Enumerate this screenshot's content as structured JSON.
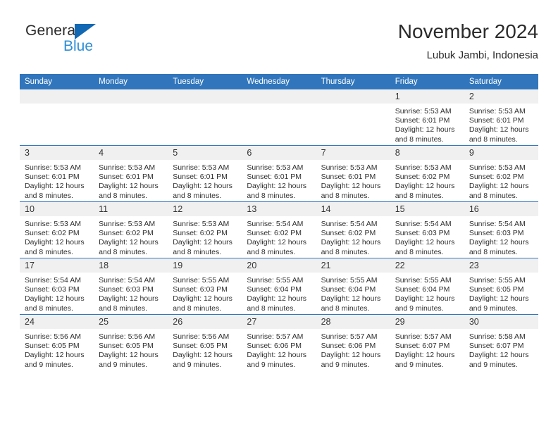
{
  "brand": {
    "name_part1": "General",
    "name_part2": "Blue",
    "triangle_color": "#1268b3",
    "blue_color": "#2e8ed6"
  },
  "header": {
    "title": "November 2024",
    "subtitle": "Lubuk Jambi, Indonesia"
  },
  "theme": {
    "header_blue": "#3176bc",
    "daynum_gray": "#f0f0f0",
    "text_color": "#2f2f2f"
  },
  "weekdays": [
    "Sunday",
    "Monday",
    "Tuesday",
    "Wednesday",
    "Thursday",
    "Friday",
    "Saturday"
  ],
  "weeks": [
    [
      {
        "day": "",
        "sunrise": "",
        "sunset": "",
        "daylight1": "",
        "daylight2": ""
      },
      {
        "day": "",
        "sunrise": "",
        "sunset": "",
        "daylight1": "",
        "daylight2": ""
      },
      {
        "day": "",
        "sunrise": "",
        "sunset": "",
        "daylight1": "",
        "daylight2": ""
      },
      {
        "day": "",
        "sunrise": "",
        "sunset": "",
        "daylight1": "",
        "daylight2": ""
      },
      {
        "day": "",
        "sunrise": "",
        "sunset": "",
        "daylight1": "",
        "daylight2": ""
      },
      {
        "day": "1",
        "sunrise": "Sunrise: 5:53 AM",
        "sunset": "Sunset: 6:01 PM",
        "daylight1": "Daylight: 12 hours",
        "daylight2": "and 8 minutes."
      },
      {
        "day": "2",
        "sunrise": "Sunrise: 5:53 AM",
        "sunset": "Sunset: 6:01 PM",
        "daylight1": "Daylight: 12 hours",
        "daylight2": "and 8 minutes."
      }
    ],
    [
      {
        "day": "3",
        "sunrise": "Sunrise: 5:53 AM",
        "sunset": "Sunset: 6:01 PM",
        "daylight1": "Daylight: 12 hours",
        "daylight2": "and 8 minutes."
      },
      {
        "day": "4",
        "sunrise": "Sunrise: 5:53 AM",
        "sunset": "Sunset: 6:01 PM",
        "daylight1": "Daylight: 12 hours",
        "daylight2": "and 8 minutes."
      },
      {
        "day": "5",
        "sunrise": "Sunrise: 5:53 AM",
        "sunset": "Sunset: 6:01 PM",
        "daylight1": "Daylight: 12 hours",
        "daylight2": "and 8 minutes."
      },
      {
        "day": "6",
        "sunrise": "Sunrise: 5:53 AM",
        "sunset": "Sunset: 6:01 PM",
        "daylight1": "Daylight: 12 hours",
        "daylight2": "and 8 minutes."
      },
      {
        "day": "7",
        "sunrise": "Sunrise: 5:53 AM",
        "sunset": "Sunset: 6:01 PM",
        "daylight1": "Daylight: 12 hours",
        "daylight2": "and 8 minutes."
      },
      {
        "day": "8",
        "sunrise": "Sunrise: 5:53 AM",
        "sunset": "Sunset: 6:02 PM",
        "daylight1": "Daylight: 12 hours",
        "daylight2": "and 8 minutes."
      },
      {
        "day": "9",
        "sunrise": "Sunrise: 5:53 AM",
        "sunset": "Sunset: 6:02 PM",
        "daylight1": "Daylight: 12 hours",
        "daylight2": "and 8 minutes."
      }
    ],
    [
      {
        "day": "10",
        "sunrise": "Sunrise: 5:53 AM",
        "sunset": "Sunset: 6:02 PM",
        "daylight1": "Daylight: 12 hours",
        "daylight2": "and 8 minutes."
      },
      {
        "day": "11",
        "sunrise": "Sunrise: 5:53 AM",
        "sunset": "Sunset: 6:02 PM",
        "daylight1": "Daylight: 12 hours",
        "daylight2": "and 8 minutes."
      },
      {
        "day": "12",
        "sunrise": "Sunrise: 5:53 AM",
        "sunset": "Sunset: 6:02 PM",
        "daylight1": "Daylight: 12 hours",
        "daylight2": "and 8 minutes."
      },
      {
        "day": "13",
        "sunrise": "Sunrise: 5:54 AM",
        "sunset": "Sunset: 6:02 PM",
        "daylight1": "Daylight: 12 hours",
        "daylight2": "and 8 minutes."
      },
      {
        "day": "14",
        "sunrise": "Sunrise: 5:54 AM",
        "sunset": "Sunset: 6:02 PM",
        "daylight1": "Daylight: 12 hours",
        "daylight2": "and 8 minutes."
      },
      {
        "day": "15",
        "sunrise": "Sunrise: 5:54 AM",
        "sunset": "Sunset: 6:03 PM",
        "daylight1": "Daylight: 12 hours",
        "daylight2": "and 8 minutes."
      },
      {
        "day": "16",
        "sunrise": "Sunrise: 5:54 AM",
        "sunset": "Sunset: 6:03 PM",
        "daylight1": "Daylight: 12 hours",
        "daylight2": "and 8 minutes."
      }
    ],
    [
      {
        "day": "17",
        "sunrise": "Sunrise: 5:54 AM",
        "sunset": "Sunset: 6:03 PM",
        "daylight1": "Daylight: 12 hours",
        "daylight2": "and 8 minutes."
      },
      {
        "day": "18",
        "sunrise": "Sunrise: 5:54 AM",
        "sunset": "Sunset: 6:03 PM",
        "daylight1": "Daylight: 12 hours",
        "daylight2": "and 8 minutes."
      },
      {
        "day": "19",
        "sunrise": "Sunrise: 5:55 AM",
        "sunset": "Sunset: 6:03 PM",
        "daylight1": "Daylight: 12 hours",
        "daylight2": "and 8 minutes."
      },
      {
        "day": "20",
        "sunrise": "Sunrise: 5:55 AM",
        "sunset": "Sunset: 6:04 PM",
        "daylight1": "Daylight: 12 hours",
        "daylight2": "and 8 minutes."
      },
      {
        "day": "21",
        "sunrise": "Sunrise: 5:55 AM",
        "sunset": "Sunset: 6:04 PM",
        "daylight1": "Daylight: 12 hours",
        "daylight2": "and 8 minutes."
      },
      {
        "day": "22",
        "sunrise": "Sunrise: 5:55 AM",
        "sunset": "Sunset: 6:04 PM",
        "daylight1": "Daylight: 12 hours",
        "daylight2": "and 9 minutes."
      },
      {
        "day": "23",
        "sunrise": "Sunrise: 5:55 AM",
        "sunset": "Sunset: 6:05 PM",
        "daylight1": "Daylight: 12 hours",
        "daylight2": "and 9 minutes."
      }
    ],
    [
      {
        "day": "24",
        "sunrise": "Sunrise: 5:56 AM",
        "sunset": "Sunset: 6:05 PM",
        "daylight1": "Daylight: 12 hours",
        "daylight2": "and 9 minutes."
      },
      {
        "day": "25",
        "sunrise": "Sunrise: 5:56 AM",
        "sunset": "Sunset: 6:05 PM",
        "daylight1": "Daylight: 12 hours",
        "daylight2": "and 9 minutes."
      },
      {
        "day": "26",
        "sunrise": "Sunrise: 5:56 AM",
        "sunset": "Sunset: 6:05 PM",
        "daylight1": "Daylight: 12 hours",
        "daylight2": "and 9 minutes."
      },
      {
        "day": "27",
        "sunrise": "Sunrise: 5:57 AM",
        "sunset": "Sunset: 6:06 PM",
        "daylight1": "Daylight: 12 hours",
        "daylight2": "and 9 minutes."
      },
      {
        "day": "28",
        "sunrise": "Sunrise: 5:57 AM",
        "sunset": "Sunset: 6:06 PM",
        "daylight1": "Daylight: 12 hours",
        "daylight2": "and 9 minutes."
      },
      {
        "day": "29",
        "sunrise": "Sunrise: 5:57 AM",
        "sunset": "Sunset: 6:07 PM",
        "daylight1": "Daylight: 12 hours",
        "daylight2": "and 9 minutes."
      },
      {
        "day": "30",
        "sunrise": "Sunrise: 5:58 AM",
        "sunset": "Sunset: 6:07 PM",
        "daylight1": "Daylight: 12 hours",
        "daylight2": "and 9 minutes."
      }
    ]
  ]
}
